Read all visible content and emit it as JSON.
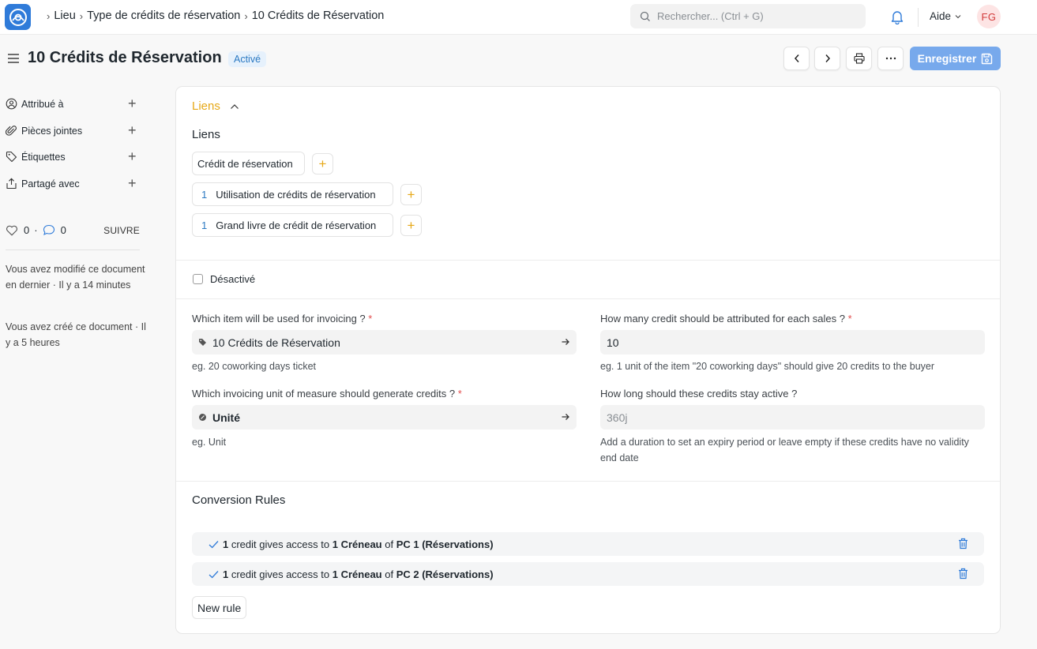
{
  "navbar": {
    "breadcrumbs": [
      "Lieu",
      "Type de crédits de réservation",
      "10 Crédits de Réservation"
    ],
    "search_placeholder": "Rechercher... (Ctrl + G)",
    "help_label": "Aide",
    "avatar_initials": "FG"
  },
  "header": {
    "title": "10 Crédits de Réservation",
    "status": "Activé",
    "save_label": "Enregistrer"
  },
  "sidebar": {
    "actions": [
      {
        "label": "Attribué à",
        "icon": "user-circle-icon"
      },
      {
        "label": "Pièces jointes",
        "icon": "paperclip-icon"
      },
      {
        "label": "Étiquettes",
        "icon": "tag-icon"
      },
      {
        "label": "Partagé avec",
        "icon": "share-icon"
      }
    ],
    "likes": "0",
    "comments": "0",
    "dot": "·",
    "follow_label": "SUIVRE",
    "modified_note": "Vous avez modifié ce document en dernier · Il y a 14 minutes",
    "created_note": "Vous avez créé ce document · Il y a 5 heures"
  },
  "links_section": {
    "heading": "Liens",
    "subheading": "Liens",
    "items": [
      {
        "count": "",
        "label": "Crédit de réservation"
      },
      {
        "count": "1",
        "label": "Utilisation de crédits de réservation"
      },
      {
        "count": "1",
        "label": "Grand livre de crédit de réservation"
      }
    ],
    "add_symbol": "+"
  },
  "disabled_checkbox": {
    "label": "Désactivé",
    "checked": false
  },
  "form": {
    "item_label": "Which item will be used for invoicing ?",
    "item_value": "10 Crédits de Réservation",
    "item_help": "eg. 20 coworking days ticket",
    "uom_label": "Which invoicing unit of measure should generate credits ?",
    "uom_value": "Unité",
    "uom_help": "eg. Unit",
    "credits_label": "How many credit should be attributed for each sales ?",
    "credits_value": "10",
    "credits_help": "eg. 1 unit of the item \"20 coworking days\" should give 20 credits to the buyer",
    "duration_label": "How long should these credits stay active ?",
    "duration_placeholder": "360j",
    "duration_help": "Add a duration to set an expiry period or leave empty if these credits have no validity end date",
    "required_mark": "*"
  },
  "conversion": {
    "title": "Conversion Rules",
    "rules": [
      {
        "qty": "1",
        "t1": " credit gives access to ",
        "qty2": "1",
        "unit": "Créneau",
        "t2": " of ",
        "target": "PC 1 (Réservations)"
      },
      {
        "qty": "1",
        "t1": " credit gives access to ",
        "qty2": "1",
        "unit": "Créneau",
        "t2": " of ",
        "target": "PC 2 (Réservations)"
      }
    ],
    "new_rule_label": "New rule"
  },
  "colors": {
    "accent": "#2f7bd9",
    "section_heading": "#e6a817",
    "save_button": "#77a9ec",
    "badge_text": "#2b79c2"
  }
}
